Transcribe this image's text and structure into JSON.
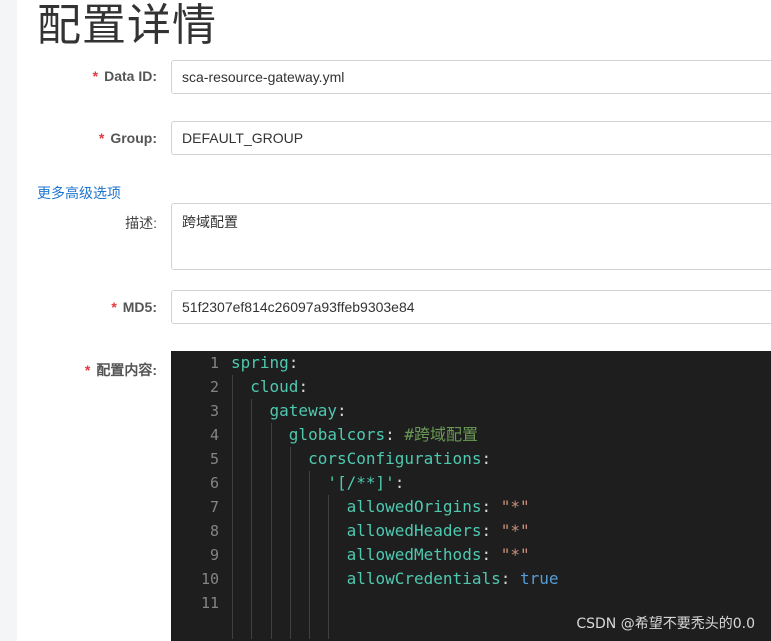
{
  "page": {
    "title": "配置详情"
  },
  "form": {
    "data_id": {
      "label": "Data ID:",
      "value": "sca-resource-gateway.yml"
    },
    "group": {
      "label": "Group:",
      "value": "DEFAULT_GROUP"
    },
    "advanced_link": "更多高级选项",
    "description": {
      "label": "描述:",
      "value": "跨域配置"
    },
    "md5": {
      "label": "MD5:",
      "value": "51f2307ef814c26097a93ffeb9303e84"
    },
    "content": {
      "label": "配置内容:"
    },
    "required_mark": "*"
  },
  "editor": {
    "lines": [
      {
        "num": "1",
        "segs": [
          [
            "k",
            "spring"
          ],
          [
            "p",
            ":"
          ]
        ]
      },
      {
        "num": "2",
        "segs": [
          [
            "p",
            "  "
          ],
          [
            "k",
            "cloud"
          ],
          [
            "p",
            ":"
          ]
        ]
      },
      {
        "num": "3",
        "segs": [
          [
            "p",
            "    "
          ],
          [
            "k",
            "gateway"
          ],
          [
            "p",
            ":"
          ]
        ]
      },
      {
        "num": "4",
        "segs": [
          [
            "p",
            "      "
          ],
          [
            "k",
            "globalcors"
          ],
          [
            "p",
            ": "
          ],
          [
            "c",
            "#跨域配置"
          ]
        ]
      },
      {
        "num": "5",
        "segs": [
          [
            "p",
            "        "
          ],
          [
            "k",
            "corsConfigurations"
          ],
          [
            "p",
            ":"
          ]
        ]
      },
      {
        "num": "6",
        "segs": [
          [
            "p",
            "          "
          ],
          [
            "k",
            "'[/**]'"
          ],
          [
            "p",
            ":"
          ]
        ]
      },
      {
        "num": "7",
        "segs": [
          [
            "p",
            "            "
          ],
          [
            "k",
            "allowedOrigins"
          ],
          [
            "p",
            ": "
          ],
          [
            "s",
            "\"*\""
          ]
        ]
      },
      {
        "num": "8",
        "segs": [
          [
            "p",
            "            "
          ],
          [
            "k",
            "allowedHeaders"
          ],
          [
            "p",
            ": "
          ],
          [
            "s",
            "\"*\""
          ]
        ]
      },
      {
        "num": "9",
        "segs": [
          [
            "p",
            "            "
          ],
          [
            "k",
            "allowedMethods"
          ],
          [
            "p",
            ": "
          ],
          [
            "s",
            "\"*\""
          ]
        ]
      },
      {
        "num": "10",
        "segs": [
          [
            "p",
            "            "
          ],
          [
            "k",
            "allowCredentials"
          ],
          [
            "p",
            ": "
          ],
          [
            "b",
            "true"
          ]
        ]
      },
      {
        "num": "11",
        "segs": []
      }
    ]
  },
  "watermark": "CSDN @希望不要秃头的0.0"
}
